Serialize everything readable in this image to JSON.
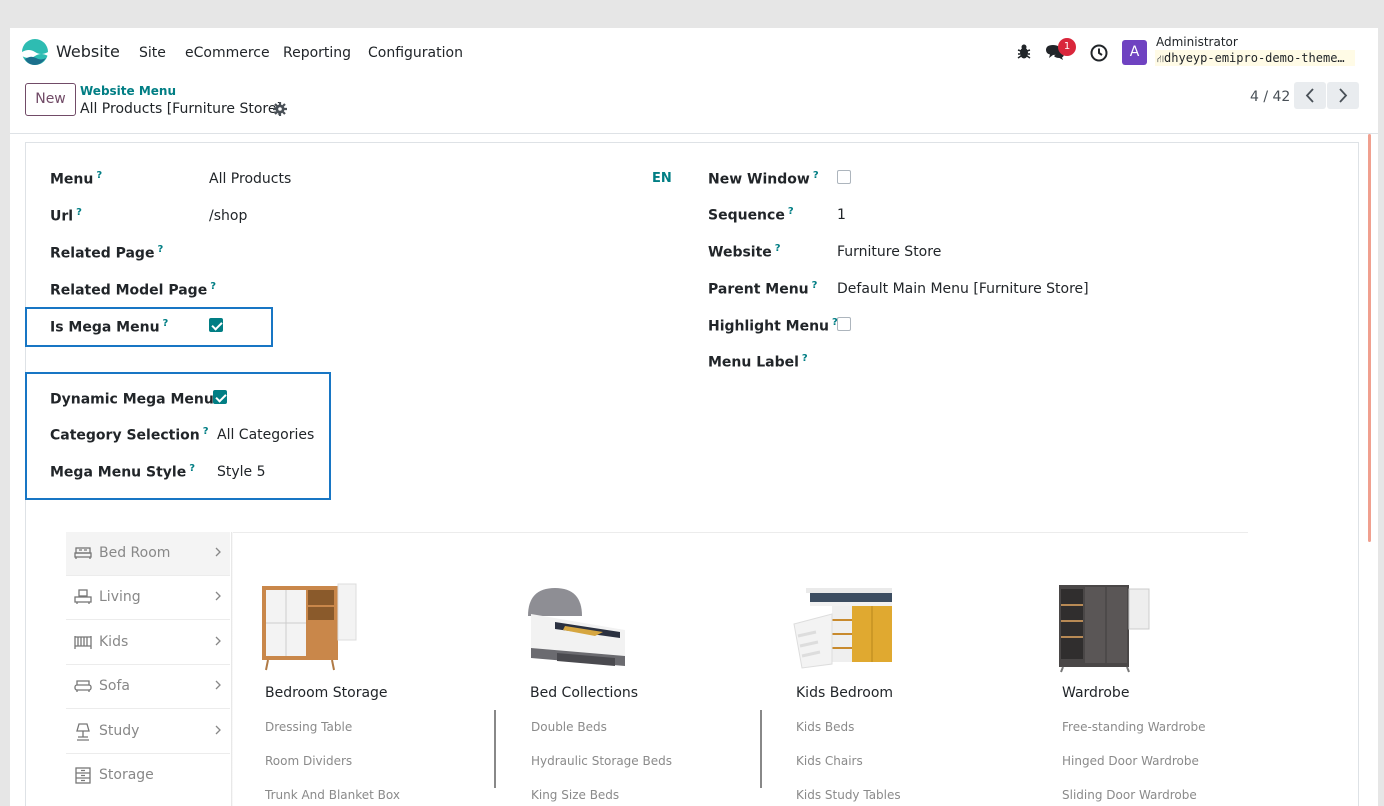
{
  "navbar": {
    "app_name": "Website",
    "menu": [
      "Site",
      "eCommerce",
      "Reporting",
      "Configuration"
    ],
    "notification_count": "1",
    "user_initial": "A",
    "user_name": "Administrator",
    "db_name": "dhyeyp-emipro-demo-theme…"
  },
  "control": {
    "new_label": "New",
    "breadcrumb": "Website Menu",
    "record_title": "All Products [Furniture Store]",
    "pager": "4 / 42"
  },
  "form": {
    "left_fields": [
      {
        "label": "Menu",
        "value": "All Products"
      },
      {
        "label": "Url",
        "value": "/shop"
      },
      {
        "label": "Related Page",
        "value": ""
      },
      {
        "label": "Related Model Page",
        "value": ""
      },
      {
        "label": "Is Mega Menu",
        "checked": true
      }
    ],
    "lang": "EN",
    "right_fields": [
      {
        "label": "New Window",
        "checked": false
      },
      {
        "label": "Sequence",
        "value": "1"
      },
      {
        "label": "Website",
        "value": "Furniture Store"
      },
      {
        "label": "Parent Menu",
        "value": "Default Main Menu [Furniture Store]"
      },
      {
        "label": "Highlight Menu",
        "checked": false
      },
      {
        "label": "Menu Label",
        "value": ""
      }
    ],
    "mega_fields": [
      {
        "label": "Dynamic Mega Menu",
        "checked": true
      },
      {
        "label": "Category Selection",
        "value": "All Categories"
      },
      {
        "label": "Mega Menu Style",
        "value": "Style 5"
      }
    ],
    "help_mark": "?"
  },
  "preview": {
    "sidebar": [
      {
        "label": "Bed Room",
        "icon": "bed-icon",
        "active": true
      },
      {
        "label": "Living",
        "icon": "living-icon"
      },
      {
        "label": "Kids",
        "icon": "crib-icon"
      },
      {
        "label": "Sofa",
        "icon": "sofa-icon"
      },
      {
        "label": "Study",
        "icon": "lamp-icon"
      },
      {
        "label": "Storage",
        "icon": "storage-icon"
      }
    ],
    "columns": [
      {
        "title": "Bedroom Storage",
        "links": [
          "Dressing Table",
          "Room Dividers",
          "Trunk And Blanket Box"
        ]
      },
      {
        "title": "Bed Collections",
        "links": [
          "Double Beds",
          "Hydraulic Storage Beds",
          "King Size Beds"
        ]
      },
      {
        "title": "Kids Bedroom",
        "links": [
          "Kids Beds",
          "Kids Chairs",
          "Kids Study Tables"
        ]
      },
      {
        "title": "Wardrobe",
        "links": [
          "Free-standing Wardrobe",
          "Hinged Door Wardrobe",
          "Sliding Door Wardrobe"
        ]
      }
    ]
  },
  "colors": {
    "brand": "#714b67",
    "accent": "#017e84",
    "highlight": "#1876c4"
  }
}
